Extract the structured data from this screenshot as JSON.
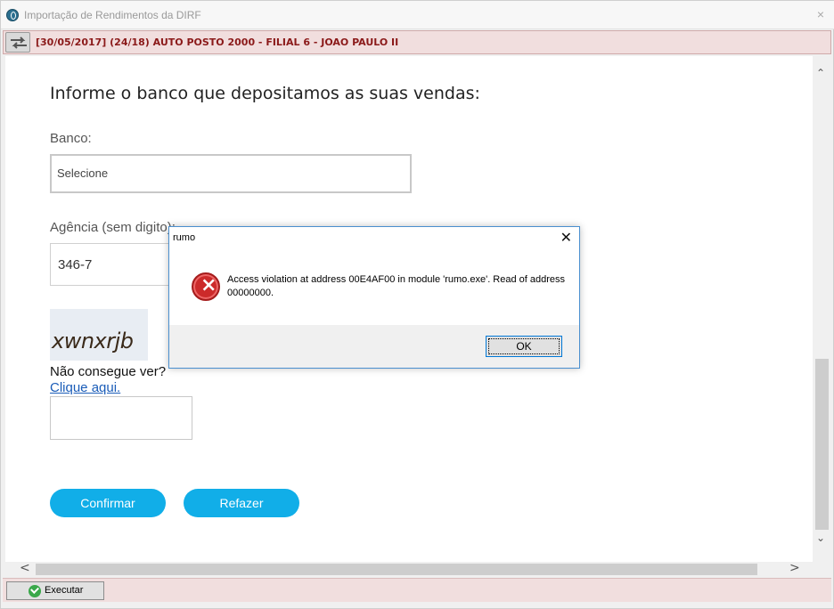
{
  "window": {
    "title": "Importação de Rendimentos da DIRF",
    "close_glyph": "×"
  },
  "info_bar": {
    "text": "[30/05/2017] (24/18) AUTO POSTO 2000 - FILIAL 6 - JOAO PAULO II",
    "text_color": "#8b1a1a",
    "background": "#f1dede"
  },
  "form": {
    "heading": "Informe o banco que depositamos as suas vendas:",
    "bank_label": "Banco:",
    "bank_select_value": "Selecione",
    "agency_label": "Agência (sem digito):",
    "agency_value": "346-7",
    "captcha_text": "xwnxrjb",
    "cant_see_text": "Não consegue ver?",
    "click_here_text": "Clique aqui.",
    "confirm_label": "Confirmar",
    "redo_label": "Refazer",
    "button_color": "#11aee8"
  },
  "scrollbars": {
    "up_arrow": "⌃",
    "down_arrow": "⌄",
    "left_arrow": "<",
    "right_arrow": ">"
  },
  "bottom_bar": {
    "execute_label": "Executar",
    "execute_icon": "check-circle-icon"
  },
  "dialog": {
    "title": "rumo",
    "close_glyph": "✕",
    "icon": "error-icon",
    "icon_glyph": "×",
    "message": "Access violation at address 00E4AF00 in module 'rumo.exe'. Read of address 00000000.",
    "ok_label": "OK"
  }
}
